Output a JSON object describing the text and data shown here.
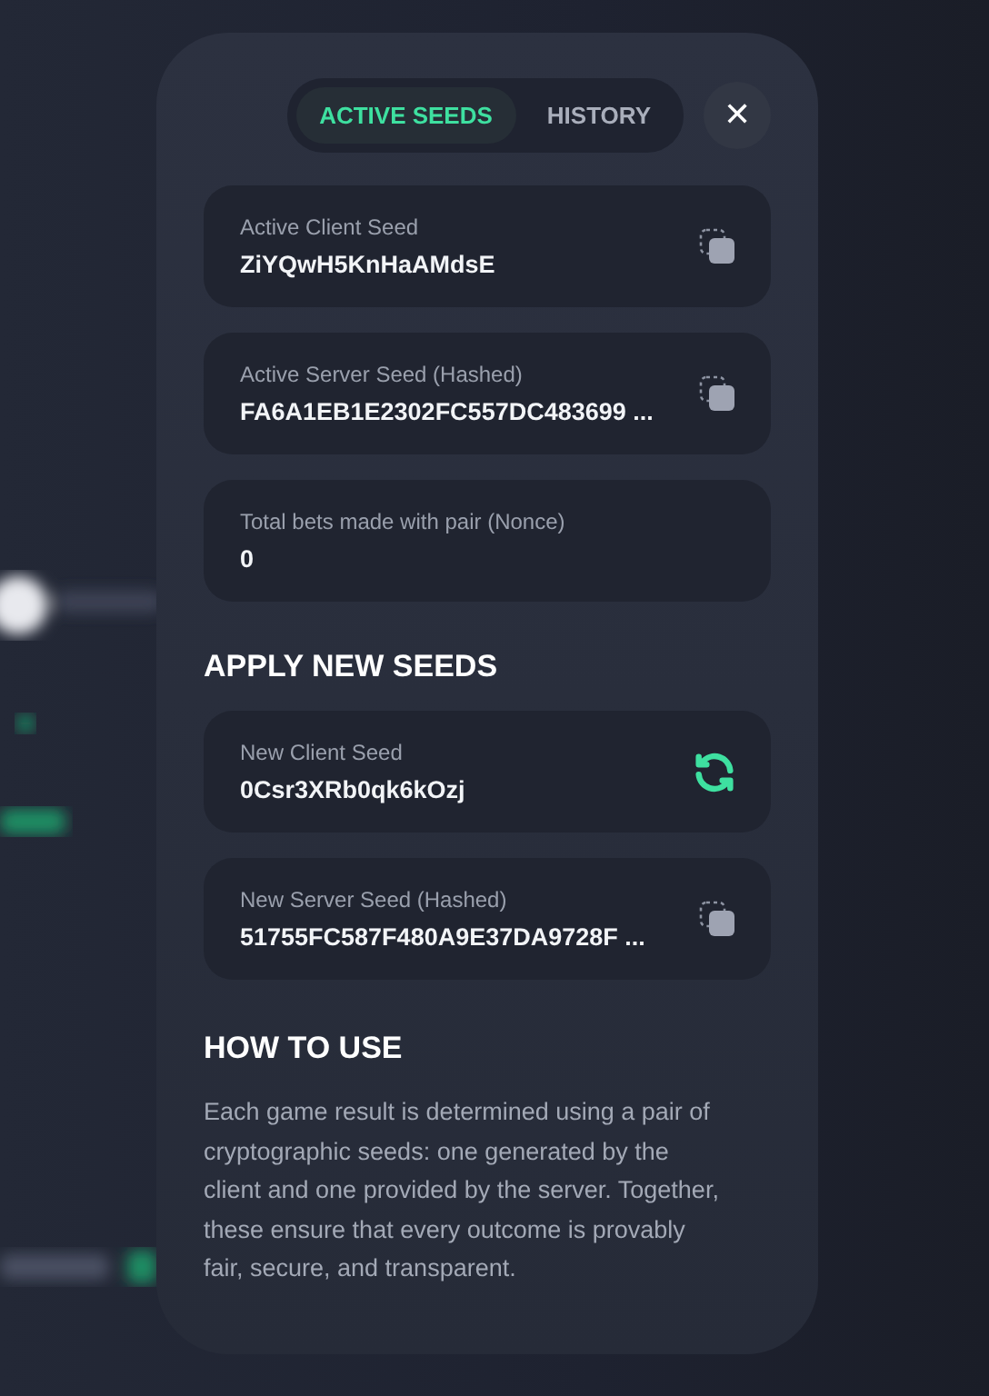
{
  "tabs": [
    {
      "label": "ACTIVE SEEDS",
      "selected": true
    },
    {
      "label": "HISTORY",
      "selected": false
    }
  ],
  "close_button": "✕",
  "active_fields": [
    {
      "label": "Active Client Seed",
      "value": "ZiYQwH5KnHaAMdsE",
      "kind": "copy"
    },
    {
      "label": "Active Server Seed (Hashed)",
      "value": "FA6A1EB1E2302FC557DC483699 ...",
      "kind": "copy"
    },
    {
      "label": "Total bets made with pair (Nonce)",
      "value": "0",
      "kind": "plain"
    }
  ],
  "apply_heading": "APPLY NEW SEEDS",
  "new_fields": [
    {
      "label": "New Client Seed",
      "value": "0Csr3XRb0qk6kOzj",
      "kind": "refresh"
    },
    {
      "label": "New Server Seed (Hashed)",
      "value": "51755FC587F480A9E37DA9728F ...",
      "kind": "copy"
    }
  ],
  "how_to_use": {
    "heading": "HOW TO USE",
    "text": "Each game result is determined using a pair of cryptographic seeds: one generated by the client and one provided by the server. Together, these ensure that every outcome is provably fair, secure, and transparent."
  }
}
